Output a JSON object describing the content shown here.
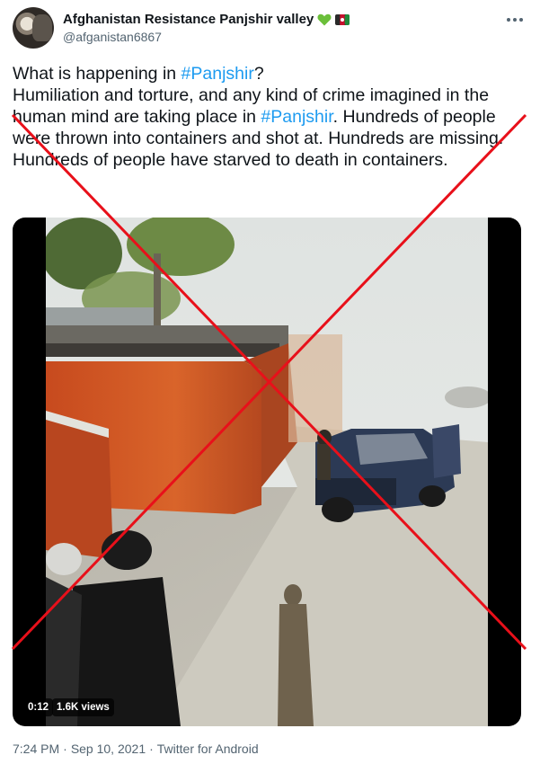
{
  "author": {
    "name": "Afghanistan Resistance Panjshir valley",
    "handle": "@afganistan6867",
    "badges": [
      "green-heart-icon",
      "flag-icon"
    ]
  },
  "tweet": {
    "line1_pre": "What is happening in ",
    "line1_tag": "#Panjshir",
    "line1_post": "?",
    "line2_pre": "Humiliation and torture, and any kind of crime imagined in the human mind are taking place in ",
    "line2_tag": "#Panjshir",
    "line2_post": ".  Hundreds of people were thrown into containers and shot at. Hundreds are missing.  Hundreds of people have starved to death in containers."
  },
  "media": {
    "duration": "0:12",
    "views": "1.6K views"
  },
  "meta": {
    "time": "7:24 PM",
    "date": "Sep 10, 2021",
    "source": "Twitter for Android",
    "separator": "·"
  },
  "colors": {
    "hashtag": "#1d9bf0",
    "cross": "#e8101a",
    "secondary_text": "#536471"
  }
}
